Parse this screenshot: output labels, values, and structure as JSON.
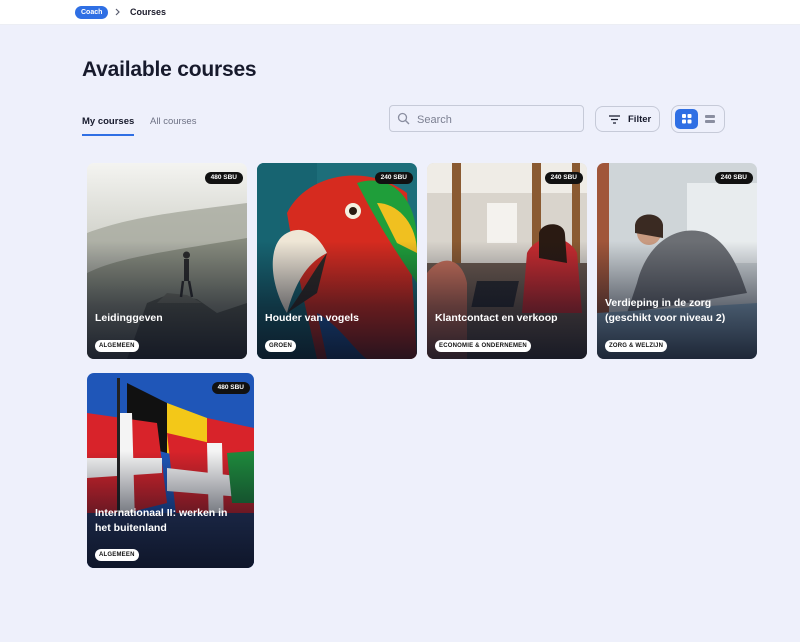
{
  "breadcrumb": {
    "root": "Coach",
    "current": "Courses"
  },
  "page": {
    "title": "Available courses"
  },
  "tabs": [
    {
      "label": "My courses",
      "active": true
    },
    {
      "label": "All courses",
      "active": false
    }
  ],
  "search": {
    "placeholder": "Search",
    "value": ""
  },
  "filter": {
    "label": "Filter"
  },
  "view": {
    "selected": "grid"
  },
  "colors": {
    "accent": "#2f6fe4",
    "background": "#eef0fb"
  },
  "courses": [
    {
      "title": "Leidinggeven",
      "sbu": "480 SBU",
      "category": "ALGEMEEN"
    },
    {
      "title": "Houder van vogels",
      "sbu": "240 SBU",
      "category": "GROEN"
    },
    {
      "title": "Klantcontact en verkoop",
      "sbu": "240 SBU",
      "category": "ECONOMIE & ONDERNEMEN"
    },
    {
      "title": "Verdieping in de zorg (geschikt voor niveau 2)",
      "sbu": "240 SBU",
      "category": "ZORG & WELZIJN"
    },
    {
      "title": "Internationaal II: werken in het buitenland",
      "sbu": "480 SBU",
      "category": "ALGEMEEN"
    }
  ]
}
